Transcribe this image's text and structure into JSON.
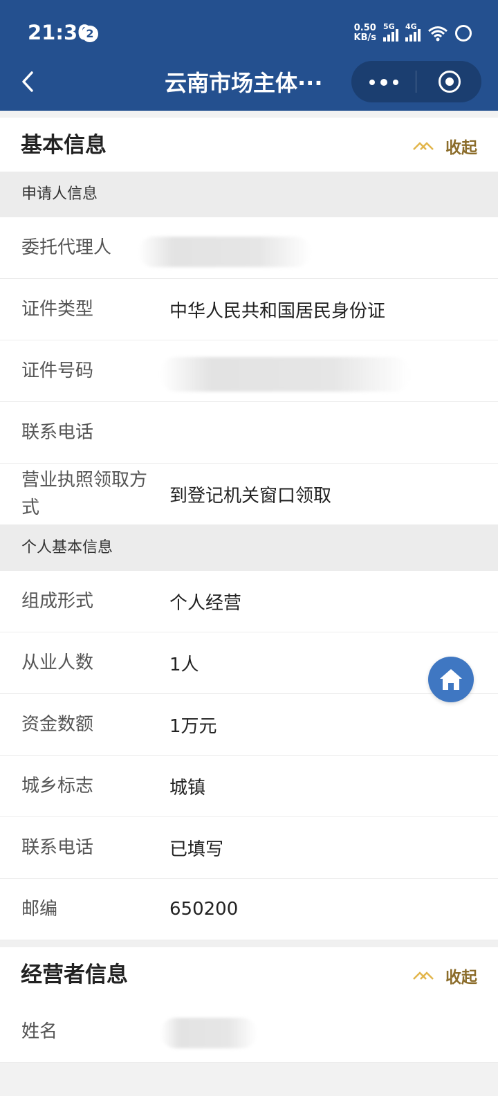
{
  "status_bar": {
    "time": "21:30",
    "notification_count": "2",
    "speed_value": "0.50",
    "speed_unit": "KB/s",
    "sim1": "5G",
    "sim2": "4G"
  },
  "nav": {
    "title": "云南市场主体···"
  },
  "basic_info": {
    "title": "基本信息",
    "collapse_label": "收起",
    "applicant_section": "申请人信息",
    "applicant_rows": [
      {
        "label": "委托代理人",
        "value": ""
      },
      {
        "label": "证件类型",
        "value": "中华人民共和国居民身份证"
      },
      {
        "label": "证件号码",
        "value": ""
      },
      {
        "label": "联系电话",
        "value": ""
      },
      {
        "label": "营业执照领取方式",
        "value": "到登记机关窗口领取"
      }
    ],
    "personal_section": "个人基本信息",
    "personal_rows": [
      {
        "label": "组成形式",
        "value": "个人经营"
      },
      {
        "label": "从业人数",
        "value": "1人"
      },
      {
        "label": "资金数额",
        "value": "1万元"
      },
      {
        "label": "城乡标志",
        "value": "城镇"
      },
      {
        "label": "联系电话",
        "value": "已填写"
      },
      {
        "label": "邮编",
        "value": "650200"
      }
    ]
  },
  "operator_info": {
    "title": "经营者信息",
    "collapse_label": "收起",
    "rows": [
      {
        "label": "姓名",
        "value": ""
      }
    ]
  },
  "colors": {
    "header_blue": "#24508f",
    "accent_gold": "#8b6c2a",
    "home_button": "#3f77c2"
  }
}
